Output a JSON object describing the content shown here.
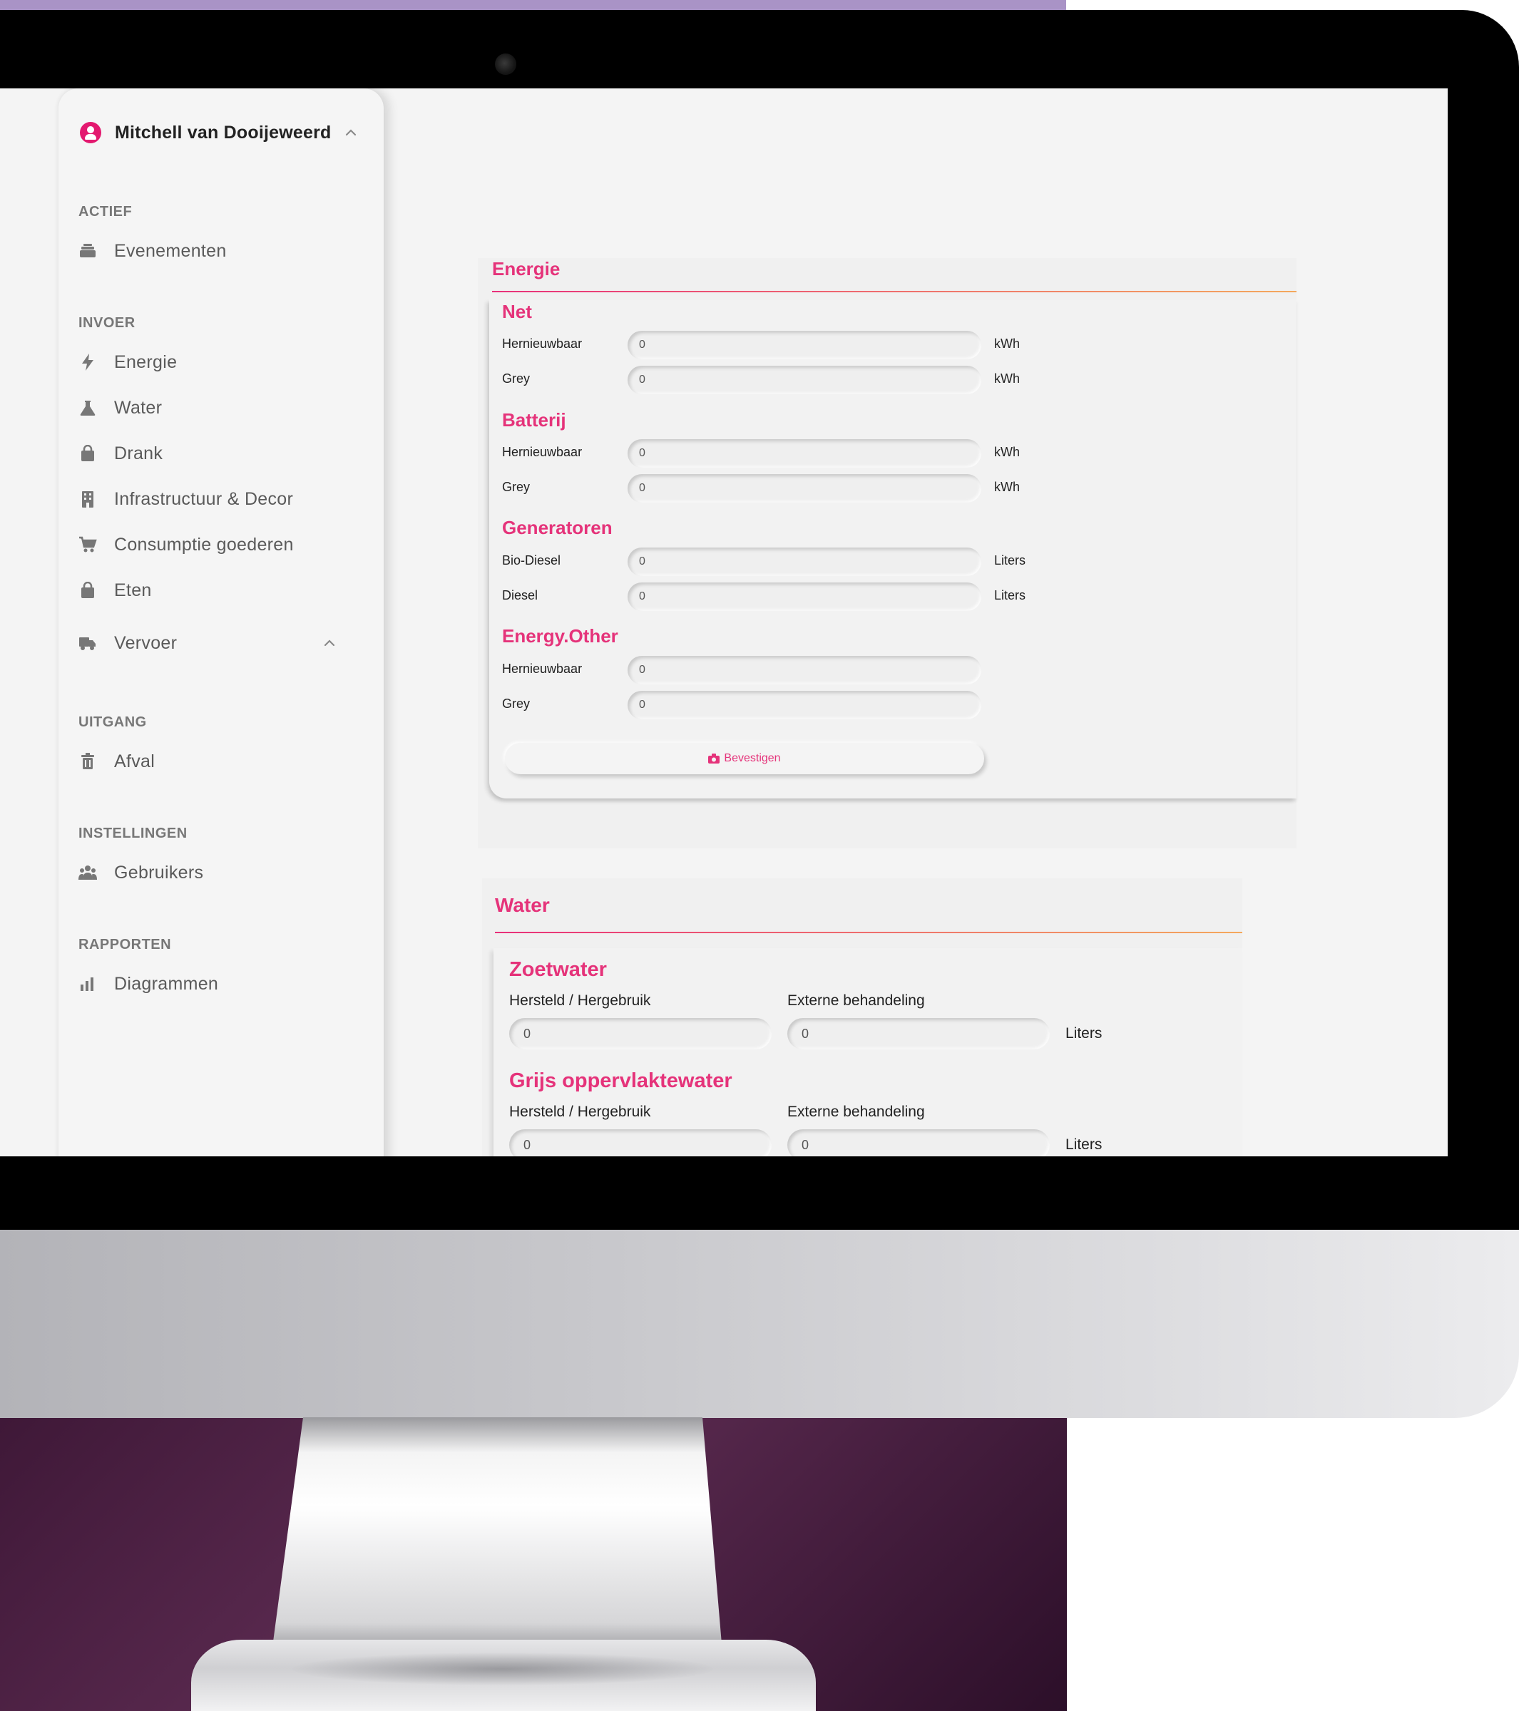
{
  "user": {
    "name": "Mitchell van Dooijeweerd"
  },
  "sidebar": {
    "sections": {
      "actief": "ACTIEF",
      "invoer": "INVOER",
      "uitgang": "UITGANG",
      "instellingen": "INSTELLINGEN",
      "rapporten": "RAPPORTEN"
    },
    "items": {
      "evenementen": {
        "label": "Evenementen",
        "icon": "layers-icon"
      },
      "energie": {
        "label": "Energie",
        "icon": "bolt-icon"
      },
      "water": {
        "label": "Water",
        "icon": "flask-icon"
      },
      "drank": {
        "label": "Drank",
        "icon": "bag-icon"
      },
      "infrastructuur": {
        "label": "Infrastructuur & Decor",
        "icon": "building-icon"
      },
      "consumptie": {
        "label": "Consumptie goederen",
        "icon": "cart-icon"
      },
      "eten": {
        "label": "Eten",
        "icon": "bag-icon"
      },
      "vervoer": {
        "label": "Vervoer",
        "icon": "truck-icon"
      },
      "afval": {
        "label": "Afval",
        "icon": "trash-icon"
      },
      "gebruikers": {
        "label": "Gebruikers",
        "icon": "users-icon"
      },
      "diagrammen": {
        "label": "Diagrammen",
        "icon": "bar-chart-icon"
      }
    }
  },
  "energy": {
    "title": "Energie",
    "net": {
      "title": "Net",
      "hernieuwbaar": {
        "label": "Hernieuwbaar",
        "value": "0",
        "unit": "kWh"
      },
      "grey": {
        "label": "Grey",
        "value": "0",
        "unit": "kWh"
      }
    },
    "batterij": {
      "title": "Batterij",
      "hernieuwbaar": {
        "label": "Hernieuwbaar",
        "value": "0",
        "unit": "kWh"
      },
      "grey": {
        "label": "Grey",
        "value": "0",
        "unit": "kWh"
      }
    },
    "generatoren": {
      "title": "Generatoren",
      "biodiesel": {
        "label": "Bio-Diesel",
        "value": "0",
        "unit": "Liters"
      },
      "diesel": {
        "label": "Diesel",
        "value": "0",
        "unit": "Liters"
      }
    },
    "other": {
      "title": "Energy.Other",
      "hernieuwbaar": {
        "label": "Hernieuwbaar",
        "value": "0"
      },
      "grey": {
        "label": "Grey",
        "value": "0"
      }
    },
    "confirm_label": "Bevestigen"
  },
  "water": {
    "title": "Water",
    "zoetwater": {
      "title": "Zoetwater",
      "hersteld": {
        "label": "Hersteld / Hergebruik",
        "value": "0"
      },
      "extern": {
        "label": "Externe behandeling",
        "value": "0"
      },
      "unit": "Liters"
    },
    "grijs": {
      "title": "Grijs oppervlaktewater",
      "hersteld": {
        "label": "Hersteld / Hergebruik",
        "value": "0"
      },
      "extern": {
        "label": "Externe behandeling",
        "value": "0"
      },
      "unit": "Liters"
    }
  },
  "colors": {
    "accent": "#e5337a",
    "sidebar_text": "#5a5a5a",
    "section_text": "#777777",
    "screen_background": "#f4f4f4"
  }
}
